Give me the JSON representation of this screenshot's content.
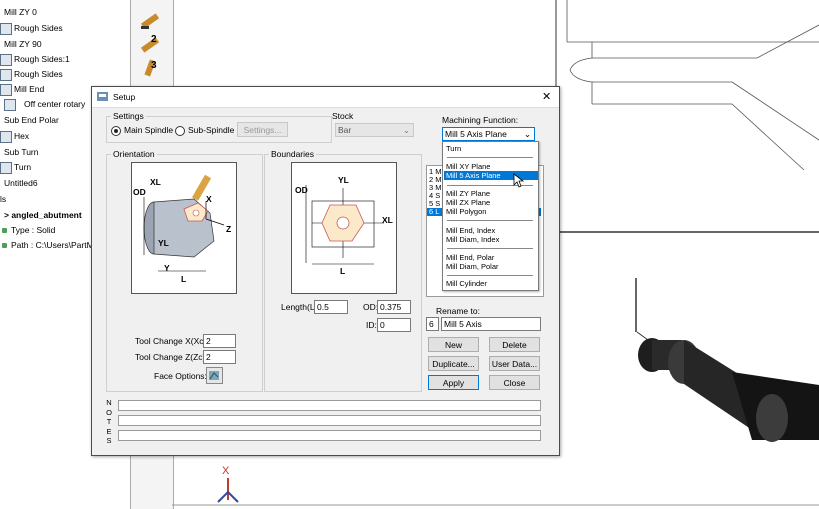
{
  "tree": {
    "items": [
      {
        "label": "Mill ZY 0"
      },
      {
        "label": "Rough Sides"
      },
      {
        "label": "Mill ZY 90"
      },
      {
        "label": "Rough Sides:1"
      },
      {
        "label": "Rough Sides"
      },
      {
        "label": "Mill End"
      },
      {
        "label": "Off center rotary"
      },
      {
        "label": "Sub End Polar"
      },
      {
        "label": "Hex"
      },
      {
        "label": "Sub Turn"
      },
      {
        "label": "Turn"
      },
      {
        "label": "Untitled6"
      },
      {
        "label": "ls"
      },
      {
        "label": "> angled_abutment"
      },
      {
        "label": "Type : Solid"
      },
      {
        "label": "Path : C:\\Users\\PartM"
      }
    ]
  },
  "dialog": {
    "title": "Setup",
    "settings": {
      "title": "Settings",
      "main_spindle": "Main Spindle",
      "sub_spindle": "Sub-Spindle",
      "settings_button": "Settings..."
    },
    "stock": {
      "title": "Stock",
      "value": "Bar"
    },
    "machining": {
      "title": "Machining Function:",
      "selected": "Mill 5 Axis Plane",
      "options": [
        "Turn",
        "Mill XY Plane",
        "Mill 5 Axis Plane",
        "Mill ZY Plane",
        "Mill ZX Plane",
        "Mill Polygon",
        "Mill End, Index",
        "Mill Diam, Index",
        "Mill End, Polar",
        "Mill Diam, Polar",
        "Mill Cylinder"
      ]
    },
    "list_rows": [
      "1 M",
      "2 M",
      "3 M",
      "4 S",
      "5 S",
      "6 L"
    ],
    "orientation": {
      "title": "Orientation",
      "labels": {
        "od": "OD",
        "xl": "XL",
        "x": "X",
        "z": "Z",
        "yl": "YL",
        "y": "Y",
        "l": "L"
      }
    },
    "boundaries": {
      "title": "Boundaries",
      "labels": {
        "od": "OD",
        "yl": "YL",
        "xl": "XL",
        "l": "L"
      },
      "length_label": "Length(L):",
      "length_value": "0.5",
      "od_label": "OD:",
      "od_value": "0.375",
      "id_label": "ID:",
      "id_value": "0"
    },
    "tool_change_x_label": "Tool Change X(Xc):",
    "tool_change_x_value": "2",
    "tool_change_z_label": "Tool Change Z(Zc):",
    "tool_change_z_value": "2",
    "face_options_label": "Face Options:",
    "rename": {
      "label": "Rename to:",
      "number": "6",
      "value": "Mill 5 Axis"
    },
    "buttons": {
      "new": "New",
      "delete": "Delete",
      "duplicate": "Duplicate...",
      "user_data": "User Data...",
      "apply": "Apply",
      "close": "Close"
    },
    "notes_letters": [
      "N",
      "O",
      "T",
      "E",
      "S"
    ],
    "close_glyph": "✕"
  },
  "colors": {
    "accent": "#0078d7",
    "part_fill": "#fbe9c9",
    "part_stroke": "#c25a5a"
  }
}
